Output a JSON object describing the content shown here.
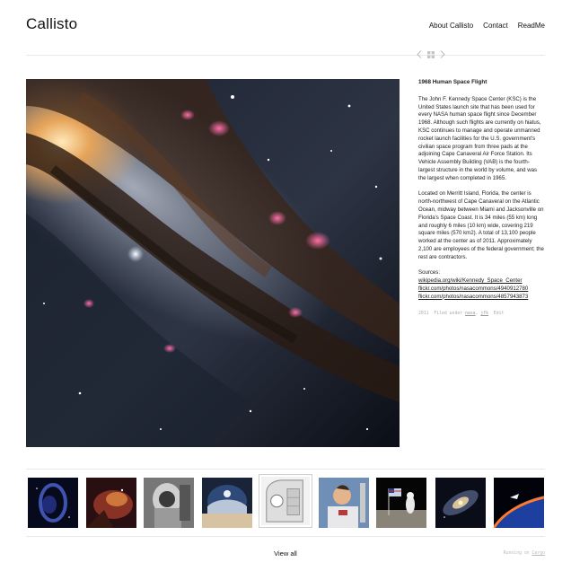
{
  "site": {
    "title": "Callisto",
    "nav": [
      {
        "label": "About Callisto"
      },
      {
        "label": "Contact"
      },
      {
        "label": "ReadMe"
      }
    ]
  },
  "project": {
    "title": "1968 Human Space Flight",
    "paragraphs": [
      "The John F. Kennedy Space Center (KSC) is the United States launch site that has been used for every NASA human space flight since December 1968. Although such flights are currently on hiatus, KSC continues to manage and operate unmanned rocket launch facilities for the U.S. government's civilian space program from three pads at the adjoining Cape Canaveral Air Force Station. Its Vehicle Assembly Building (VAB) is the fourth-largest structure in the world by volume, and was the largest when completed in 1965.",
      "Located on Merritt Island, Florida, the center is north-northwest of Cape Canaveral on the Atlantic Ocean, midway between Miami and Jacksonville on Florida's Space Coast. It is 34 miles (55 km) long and roughly 6 miles (10 km) wide, covering 219 square miles (570 km2). A total of 13,100 people worked at the center as of 2011. Approximately 2,100 are employees of the federal government; the rest are contractors."
    ],
    "sources_label": "Sources:",
    "sources": [
      "wikipedia.org/wiki/Kennedy_Space_Center",
      "flickr.com/photos/nasacommons/4940912780",
      "flickr.com/photos/nasacommons/4857943873"
    ],
    "meta": {
      "year": "2011",
      "filed_under": "Filed under",
      "tag1": "nasa",
      "tag2": "jfk",
      "edit": "Edit"
    }
  },
  "controls": {
    "prev_icon": "chevron-left-icon",
    "grid_icon": "grid-icon",
    "next_icon": "chevron-right-icon"
  },
  "thumbnails": [
    {
      "name": "nebula-blue",
      "active": false
    },
    {
      "name": "orange-nebula",
      "active": false
    },
    {
      "name": "astronaut-bw",
      "active": false
    },
    {
      "name": "helmet-reflection",
      "active": false
    },
    {
      "name": "capsule-sketch",
      "active": true
    },
    {
      "name": "astronaut-portrait",
      "active": false
    },
    {
      "name": "moon-flag",
      "active": false
    },
    {
      "name": "spiral-galaxy",
      "active": false
    },
    {
      "name": "shuttle-horizon",
      "active": false
    }
  ],
  "footer": {
    "view_all": "View all",
    "running_on": "Running on",
    "cargo": "Cargo"
  }
}
